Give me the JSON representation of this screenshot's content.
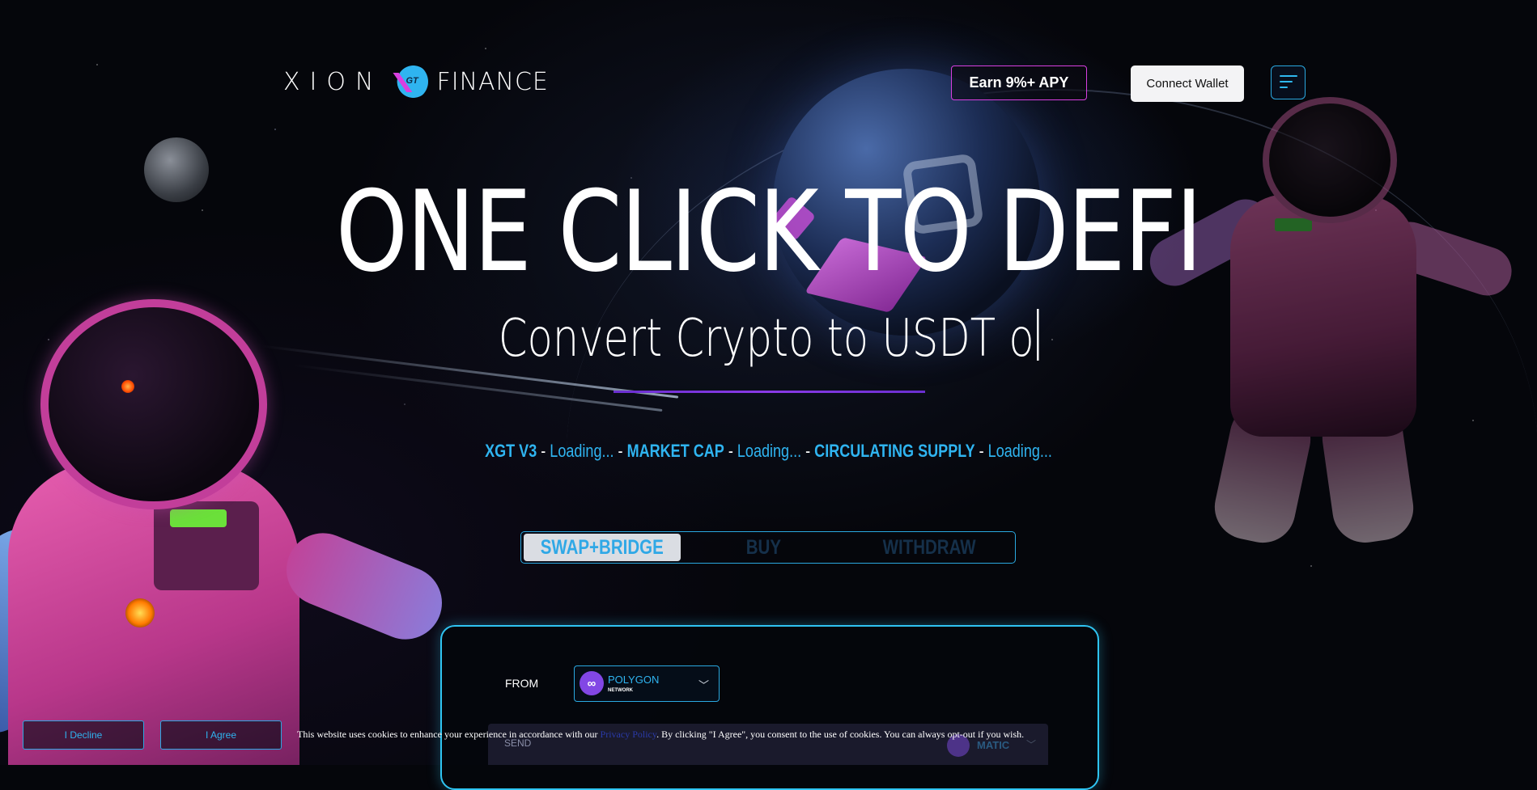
{
  "header": {
    "logo_left": "XION",
    "logo_mark": "GT",
    "logo_right": "FINANCE",
    "apy_button": "Earn 9%+ APY",
    "wallet_button": "Connect Wallet",
    "menu_icon": "hamburger-menu-icon"
  },
  "hero": {
    "title": "ONE CLICK TO DEFI",
    "subtitle": "Convert Crypto to USDT o"
  },
  "stats": {
    "token_label": "XGT V3",
    "token_value": "Loading...",
    "mcap_label": "MARKET CAP",
    "mcap_value": "Loading...",
    "supply_label": "CIRCULATING SUPPLY",
    "supply_value": "Loading...",
    "separator": " - "
  },
  "tabs": [
    {
      "label": "SWAP+BRIDGE",
      "active": true
    },
    {
      "label": "BUY",
      "active": false
    },
    {
      "label": "WITHDRAW",
      "active": false
    }
  ],
  "swap": {
    "from_label": "FROM",
    "network_name": "POLYGON",
    "network_sub": "NETWORK",
    "network_icon": "polygon-icon",
    "send_label": "SEND",
    "token_name": "MATIC",
    "token_icon": "matic-icon"
  },
  "cookie": {
    "decline": "I Decline",
    "agree": "I Agree",
    "text_before": "This website uses cookies to enhance your experience in accordance with our ",
    "link": "Privacy Policy",
    "text_after": ". By clicking \"I Agree\", you consent to the use of cookies. You can always opt-out if you wish."
  },
  "colors": {
    "accent_blue": "#2fb4f0",
    "accent_magenta": "#d73fe0",
    "divider_purple": "#7a35dc"
  }
}
